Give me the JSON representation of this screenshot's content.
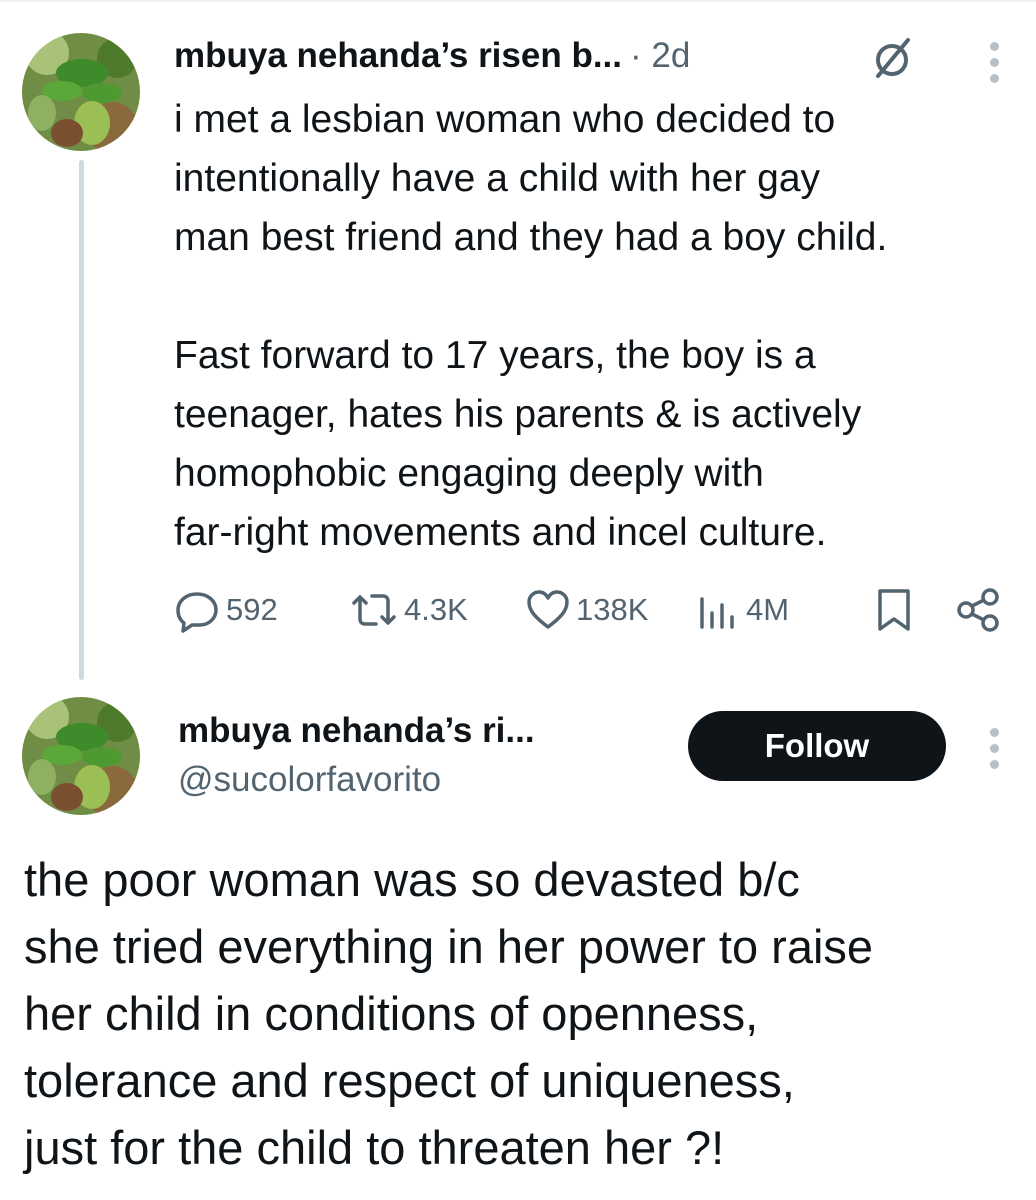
{
  "parent_tweet": {
    "author_name": "mbuya nehanda’s risen b...",
    "time": "· 2d",
    "text": "i met a lesbian woman who decided to\nintentionally have a child with her gay\nman best friend and they had a boy child.\n\nFast forward to 17 years, the boy is a\nteenager, hates his parents & is actively\nhomophobic engaging deeply with\nfar-right movements and incel culture.",
    "replies": "592",
    "reposts": "4.3K",
    "likes": "138K",
    "views": "4M"
  },
  "main_tweet": {
    "author_name": "mbuya nehanda’s ri...",
    "handle": "@sucolorfavorito",
    "follow_label": "Follow",
    "text": "the poor woman was so devasted b/c\nshe tried everything in her power to raise\nher child in conditions of openness,\ntolerance and respect of uniqueness,\njust for the child to threaten her ?!"
  },
  "colors": {
    "text_primary": "#0f1419",
    "text_secondary": "#536471",
    "thread_line": "#cfd9de",
    "follow_button_bg": "#0f1419",
    "follow_button_text": "#ffffff"
  },
  "icons": {
    "avatar": "plant-photo-avatar",
    "grok": "grok-icon",
    "more": "more-vertical-icon",
    "reply": "reply-icon",
    "repost": "repost-icon",
    "like": "heart-icon",
    "views": "views-icon",
    "bookmark": "bookmark-icon",
    "share": "share-icon"
  }
}
